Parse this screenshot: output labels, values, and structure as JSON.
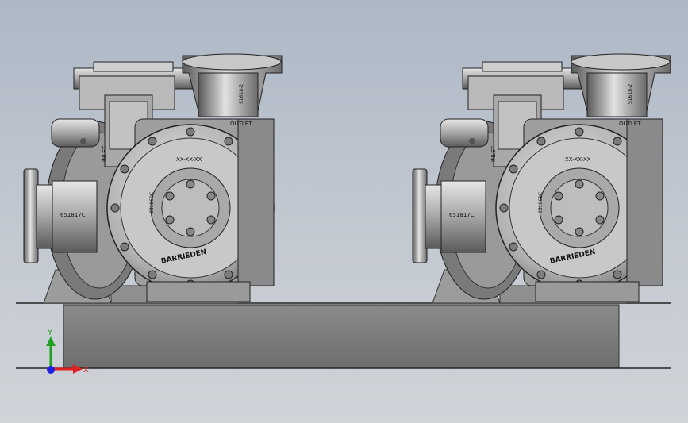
{
  "viewport": {
    "background_top": "#adb7c6",
    "background_bottom": "#d0d3d8",
    "pumps": [
      {
        "outlet_label": "OUTLET",
        "inlet_label": "INLET",
        "casing_code": "XX-XX-XX",
        "side_code": "651817C",
        "volute_code": "031869C",
        "bracket_code": "S1618-2",
        "brand_text": "BARRIEDEN"
      },
      {
        "outlet_label": "OUTLET",
        "inlet_label": "INLET",
        "casing_code": "XX-XX-XX",
        "side_code": "651817C",
        "volute_code": "031869C",
        "bracket_code": "S1618-2",
        "brand_text": "BARRIEDEN"
      }
    ],
    "triad": {
      "x_label": "X",
      "y_label": "Y",
      "x_color": "#e02020",
      "y_color": "#20a020",
      "z_color": "#2020e0"
    },
    "colors": {
      "metal_light": "#d8d8d8",
      "metal_mid": "#9a9a9a",
      "metal_dark": "#4a4a4a",
      "base": "#7f7f7f"
    }
  }
}
